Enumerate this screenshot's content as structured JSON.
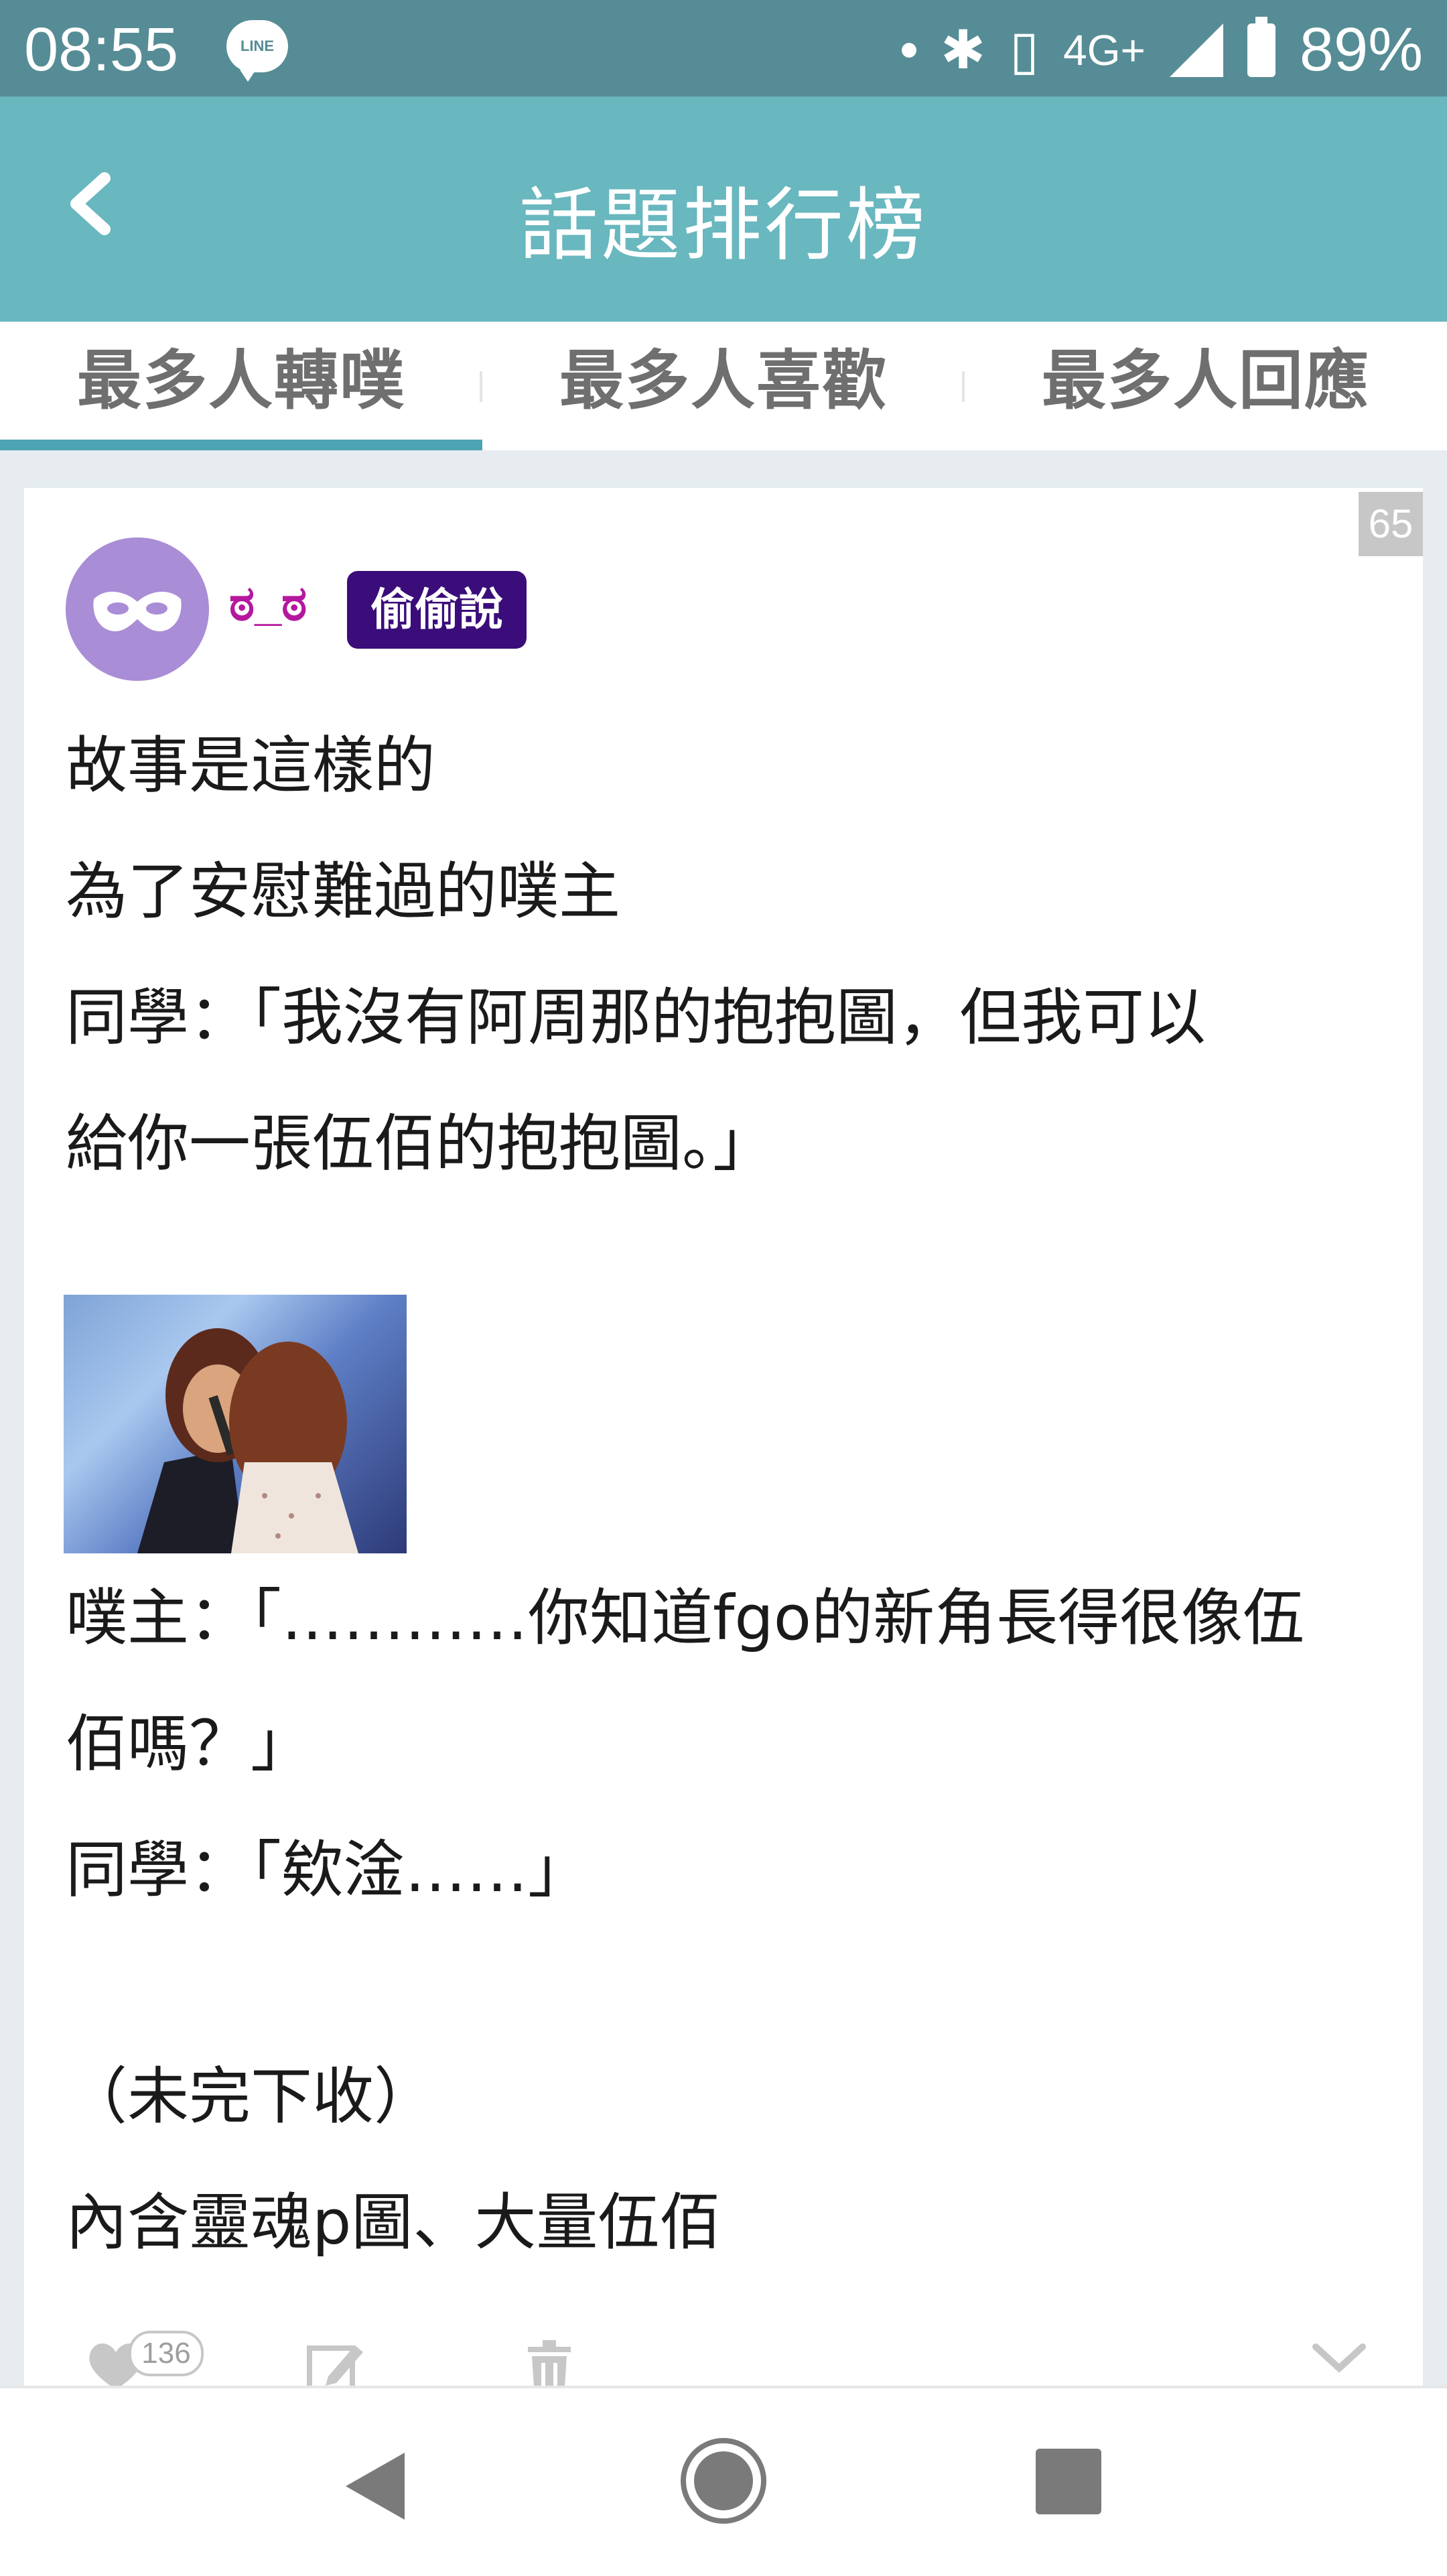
{
  "status_bar": {
    "time": "08:55",
    "notification_app_label": "LINE",
    "network_type": "4G+",
    "battery": "89%"
  },
  "header": {
    "title": "話題排行榜"
  },
  "tabs": [
    {
      "label": "最多人轉噗",
      "active": true
    },
    {
      "label": "最多人喜歡",
      "active": false
    },
    {
      "label": "最多人回應",
      "active": false
    }
  ],
  "post": {
    "rank": "65",
    "author_nickname": "ಠ_ಠ",
    "badge": "偷偷說",
    "lines": [
      "故事是這樣的",
      "為了安慰難過的噗主",
      "同學：「我沒有阿周那的抱抱圖，但我可以",
      "給你一張伍佰的抱抱圖。」",
      "噗主：「…………你知道fgo的新角長得很像伍",
      "佰嗎？」",
      "同學：「欸淦……」",
      "（未完下收）",
      "內含靈魂p圖、大量伍佰"
    ],
    "like_count": "136"
  },
  "colors": {
    "status_bar": "#568c95",
    "header": "#69b7bf",
    "tab_indicator": "#4ea4b2",
    "badge_bg": "#3a0d7a",
    "nickname": "#b5179e",
    "avatar_bg": "#a98dd6"
  }
}
